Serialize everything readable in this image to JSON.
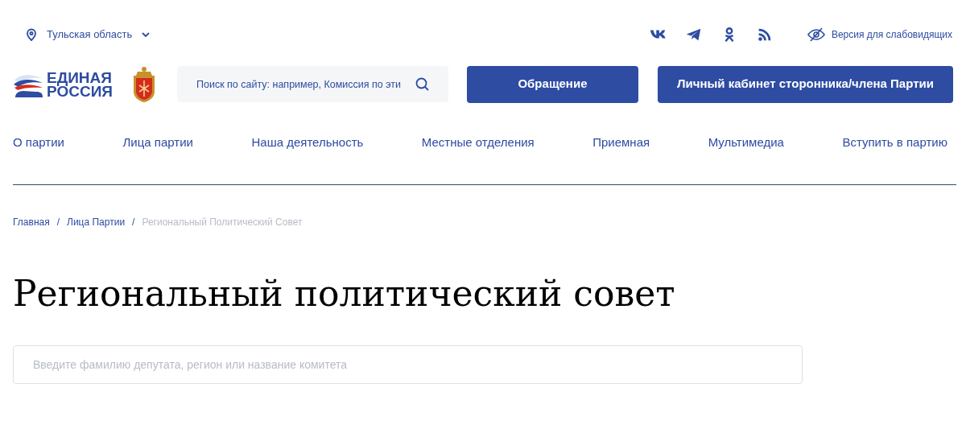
{
  "region_selector": {
    "label": "Тульская область"
  },
  "social_links": [
    {
      "kind": "vk"
    },
    {
      "kind": "telegram"
    },
    {
      "kind": "ok"
    },
    {
      "kind": "rss"
    }
  ],
  "accessibility_link": {
    "label": "Версия для слабовидящих"
  },
  "logo": {
    "line_1": "ЕДИНАЯ",
    "line_2": "РОССИЯ"
  },
  "site_search": {
    "placeholder": "Поиск по сайту: например, Комиссия по эти"
  },
  "buttons": [
    "Обращение",
    "Личный кабинет сторонника/члена Партии"
  ],
  "nav": [
    "О партии",
    "Лица партии",
    "Наша деятельность",
    "Местные отделения",
    "Приемная",
    "Мультимедиа",
    "Вступить в партию"
  ],
  "breadcrumb_separator": "/",
  "breadcrumbs": [
    {
      "label": "Главная",
      "current": false
    },
    {
      "label": "Лица Партии",
      "current": false
    },
    {
      "label": "Региональный Политический Совет",
      "current": true
    }
  ],
  "title": "Региональный политический совет",
  "deputy_search": {
    "placeholder": "Введите фамилию депутата, регион или название комитета"
  }
}
